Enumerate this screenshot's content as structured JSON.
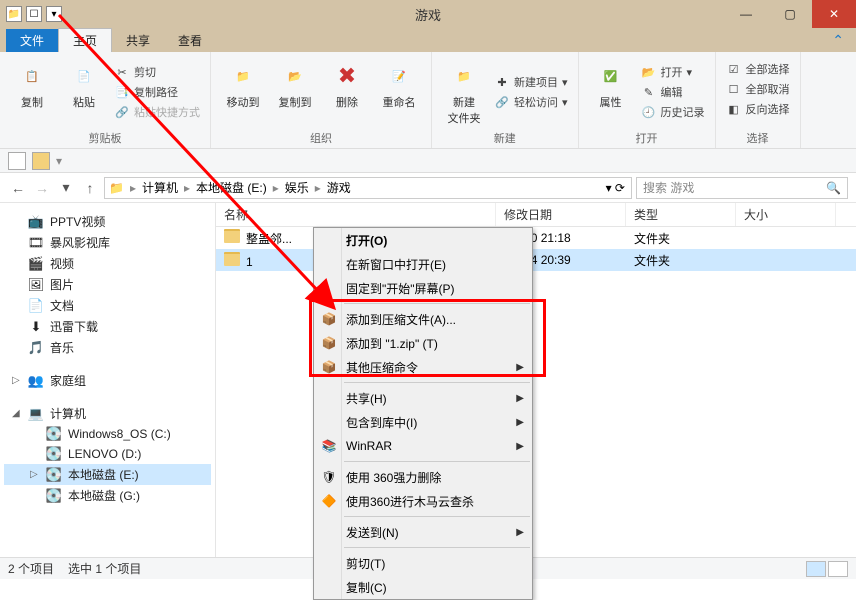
{
  "window": {
    "title": "游戏"
  },
  "tabs": {
    "file": "文件",
    "home": "主页",
    "share": "共享",
    "view": "查看"
  },
  "ribbon": {
    "clipboard": {
      "copy": "复制",
      "paste": "粘贴",
      "cut": "剪切",
      "copypath": "复制路径",
      "pasteshortcut": "粘贴快捷方式",
      "label": "剪贴板"
    },
    "organize": {
      "moveto": "移动到",
      "copyto": "复制到",
      "delete": "删除",
      "rename": "重命名",
      "label": "组织"
    },
    "new": {
      "newfolder": "新建\n文件夹",
      "newitem": "新建项目",
      "easyaccess": "轻松访问",
      "label": "新建"
    },
    "open": {
      "properties": "属性",
      "open": "打开",
      "edit": "编辑",
      "history": "历史记录",
      "label": "打开"
    },
    "select": {
      "selectall": "全部选择",
      "selectnone": "全部取消",
      "invert": "反向选择",
      "label": "选择"
    }
  },
  "address": {
    "parts": [
      "计算机",
      "本地磁盘 (E:)",
      "娱乐",
      "游戏"
    ],
    "search_placeholder": "搜索 游戏"
  },
  "nav": {
    "items": [
      {
        "label": "PPTV视频",
        "icon": "📺"
      },
      {
        "label": "暴风影视库",
        "icon": "🎞"
      },
      {
        "label": "视频",
        "icon": "🎬"
      },
      {
        "label": "图片",
        "icon": "🖼"
      },
      {
        "label": "文档",
        "icon": "📄"
      },
      {
        "label": "迅雷下载",
        "icon": "⬇"
      },
      {
        "label": "音乐",
        "icon": "🎵"
      }
    ],
    "homegroup": "家庭组",
    "computer": "计算机",
    "drives": [
      {
        "label": "Windows8_OS (C:)"
      },
      {
        "label": "LENOVO (D:)"
      },
      {
        "label": "本地磁盘 (E:)"
      },
      {
        "label": "本地磁盘 (G:)"
      }
    ]
  },
  "columns": {
    "name": "名称",
    "modified": "修改日期",
    "type": "类型",
    "size": "大小"
  },
  "files": [
    {
      "name": "整蛊邻...",
      "date": "5/6/20 21:18",
      "type": "文件夹"
    },
    {
      "name": "1",
      "date": "5/7/24 20:39",
      "type": "文件夹"
    }
  ],
  "context": {
    "open": "打开(O)",
    "newwindow": "在新窗口中打开(E)",
    "pintostart": "固定到\"开始\"屏幕(P)",
    "addarchive": "添加到压缩文件(A)...",
    "addzip": "添加到 \"1.zip\" (T)",
    "othercompress": "其他压缩命令",
    "share": "共享(H)",
    "include": "包含到库中(I)",
    "winrar": "WinRAR",
    "force360del": "使用 360强力删除",
    "trojan360": "使用360进行木马云查杀",
    "sendto": "发送到(N)",
    "cut": "剪切(T)",
    "copy": "复制(C)"
  },
  "status": {
    "count": "2 个项目",
    "selected": "选中 1 个项目"
  }
}
